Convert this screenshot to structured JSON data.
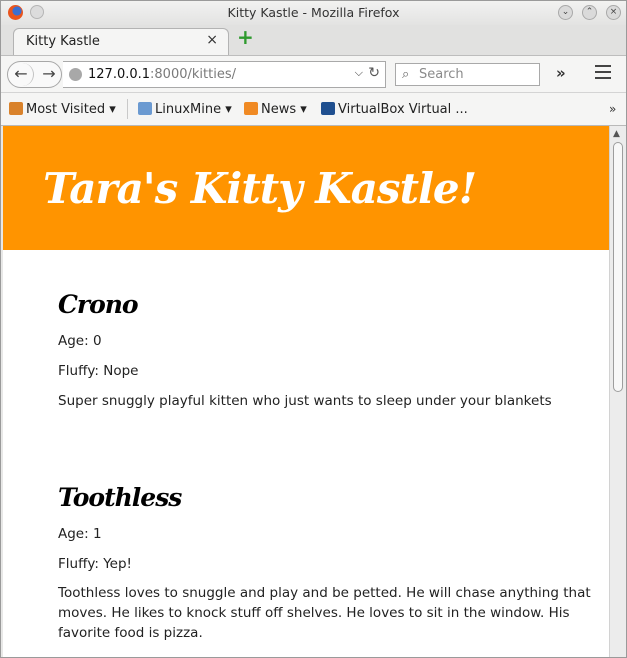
{
  "window": {
    "title": "Kitty Kastle - Mozilla Firefox"
  },
  "tab": {
    "label": "Kitty Kastle",
    "close": "×"
  },
  "newtab": "+",
  "nav": {
    "url_host": "127.0.0.1",
    "url_rest": ":8000/kitties/",
    "search_placeholder": "Search"
  },
  "bookmarks": [
    {
      "label": "Most Visited",
      "icon": "most-visited-icon",
      "color": "#d9822b"
    },
    {
      "label": "LinuxMine",
      "icon": "folder-icon",
      "color": "#6b9ad1"
    },
    {
      "label": "News",
      "icon": "rss-icon",
      "color": "#f08a24"
    },
    {
      "label": "VirtualBox Virtual ...",
      "icon": "virtualbox-icon",
      "color": "#1f4f8f"
    }
  ],
  "site": {
    "title": "Tara's Kitty Kastle!",
    "accent": "#ff9400",
    "kitties": [
      {
        "name": "Crono",
        "age": "Age: 0",
        "fluffy": "Fluffy: Nope",
        "description": "Super snuggly playful kitten who just wants to sleep under your blankets"
      },
      {
        "name": "Toothless",
        "age": "Age: 1",
        "fluffy": "Fluffy: Yep!",
        "description": "Toothless loves to snuggle and play and be petted. He will chase anything that moves. He likes to knock stuff off shelves. He loves to sit in the window. His favorite food is pizza."
      }
    ]
  }
}
